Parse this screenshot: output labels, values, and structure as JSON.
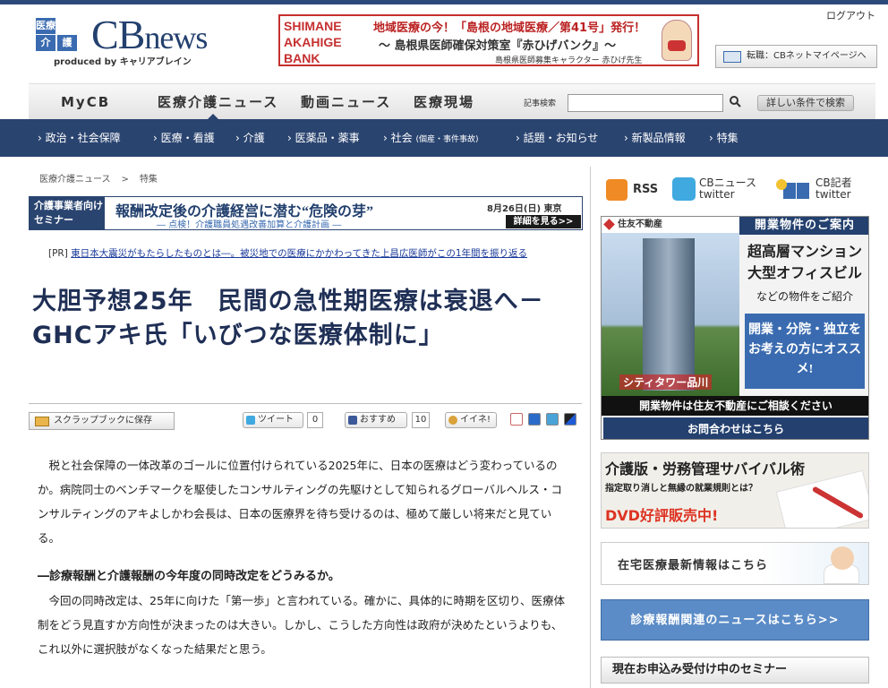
{
  "header": {
    "logo": {
      "badge1": "医療",
      "badge2": "介",
      "badge3": "護",
      "cb": "CB",
      "news": "news",
      "produced": "produced by キャリアブレイン"
    },
    "top_banner": {
      "left": "SHIMANE AKAHIGE BANK",
      "line1": "地域医療の今！「島根の地域医療／第41号」発行！",
      "line2": "〜 島根県医師確保対策室『赤ひげバンク』〜",
      "line3": "島根県医師募集キャラクター 赤ひげ先生"
    },
    "logout": "ログアウト",
    "mypage_button": "転職：CBネットマイページへ"
  },
  "mainnav": {
    "tabs": [
      "MyCB",
      "医療介護ニュース",
      "動画ニュース",
      "医療現場"
    ],
    "search_label": "記事検索",
    "search_value": "",
    "advanced_search": "詳しい条件で検索"
  },
  "subnav": {
    "items": [
      "政治・社会保障",
      "医療・看護",
      "介護",
      "医薬品・薬事",
      "社会",
      "話題・お知らせ",
      "新製品情報",
      "特集"
    ],
    "society_note": "(個産・事件事故)"
  },
  "breadcrumb": {
    "home": "医療介護ニュース",
    "sep": ">",
    "current": "特集"
  },
  "seminar_banner": {
    "tag": "介護事業者向けセミナー",
    "title": "報酬改定後の介護経営に潜む“危険の芽”",
    "subtitle": "― 点検！介護職員処遇改善加算と介護計画 ―",
    "date": "8月26日(日) 東京",
    "more": "詳細を見る>>"
  },
  "pr": {
    "label": "[PR]",
    "link": "東日本大震災がもたらしたものとは―。被災地での医療にかかわってきた上昌広医師がこの1年間を振り返る"
  },
  "article": {
    "title": "大胆予想25年　民間の急性期医療は衰退へ－ GHCアキ氏「いびつな医療体制に」",
    "p1": "税と社会保障の一体改革のゴールに位置付けられている2025年に、日本の医療はどう変わっているのか。病院同士のベンチマークを駆使したコンサルティングの先駆けとして知られるグローバルヘルス・コンサルティングのアキよしかわ会長は、日本の医療界を待ち受けるのは、極めて厳しい将来だと見ている。",
    "h1": "―診療報酬と介護報酬の今年度の同時改定をどうみるか。",
    "p2": "今回の同時改定は、25年に向けた「第一歩」と言われている。確かに、具体的に時期を区切り、医療体制をどう見直すか方向性が決まったのは大きい。しかし、こうした方向性は政府が決めたというよりも、これ以外に選択肢がなくなった結果だと思う。"
  },
  "social": {
    "scrapbook": "スクラップブックに保存",
    "tweet": "ツイート",
    "tweet_count": "0",
    "recommend": "おすすめ",
    "recommend_count": "10",
    "iine": "イイネ!"
  },
  "sidebar": {
    "rss": "RSS",
    "twitter_news": "CBニュース twitter",
    "twitter_reporter": "CB記者 twitter",
    "ad1": {
      "brand": "住友不動産",
      "building": "シティタワー品川",
      "head": "開業物件のご案内",
      "title1": "超高層マンション",
      "title2": "大型オフィスビル",
      "sub": "などの物件をご紹介",
      "blue": "開業・分院・独立をお考えの方にオススメ!",
      "bottom1": "開業物件は住友不動産にご相談ください",
      "bottom2": "お問合わせはこちら"
    },
    "ad2": {
      "title": "介護版・労務管理サバイバル術",
      "sub": "指定取り消しと無縁の就業規則とは？",
      "dvd": "DVD好評販売中!"
    },
    "ad3": "在宅医療最新情報はこちら",
    "ad4": "診療報酬関連のニュースはこちら>>",
    "seminar_heading": "現在お申込み受付け中のセミナー"
  }
}
